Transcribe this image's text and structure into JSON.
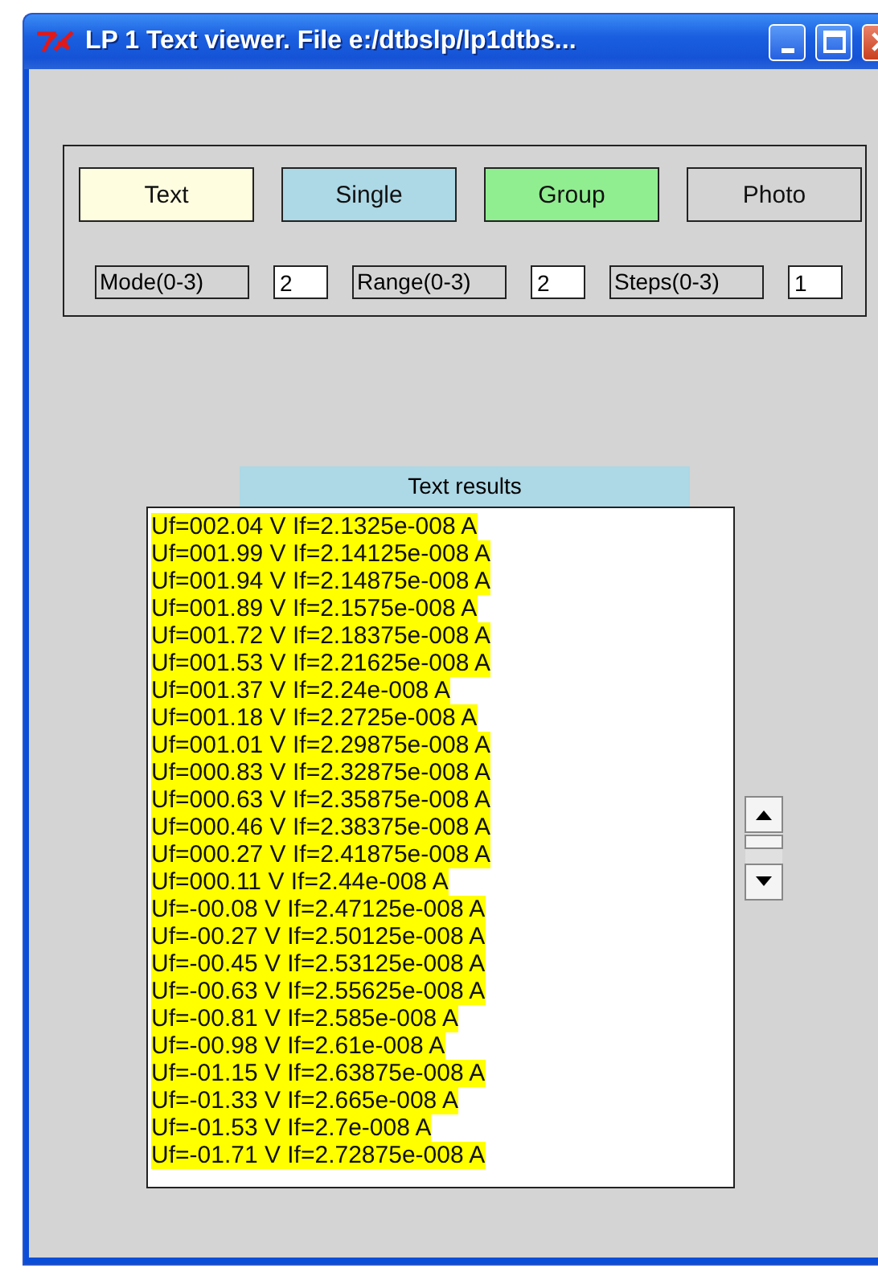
{
  "window": {
    "title": "LP 1 Text viewer. File e:/dtbslp/lp1dtbs..."
  },
  "buttons": [
    {
      "label": "Text",
      "color": "#fffde0"
    },
    {
      "label": "Single",
      "color": "#add8e6"
    },
    {
      "label": "Group",
      "color": "#90ee90"
    },
    {
      "label": "Photo",
      "color": "#d4d4d4"
    }
  ],
  "params": [
    {
      "label": "Mode(0-3)",
      "value": "2"
    },
    {
      "label": "Range(0-3)",
      "value": "2"
    },
    {
      "label": "Steps(0-3)",
      "value": "1"
    }
  ],
  "results": {
    "title": "Text results",
    "lines": [
      "Uf=002.04 V If=2.1325e-008 A",
      "Uf=001.99 V If=2.14125e-008 A",
      "Uf=001.94 V If=2.14875e-008 A",
      "Uf=001.89 V If=2.1575e-008 A",
      "Uf=001.72 V If=2.18375e-008 A",
      "Uf=001.53 V If=2.21625e-008 A",
      "Uf=001.37 V If=2.24e-008 A",
      "Uf=001.18 V If=2.2725e-008 A",
      "Uf=001.01 V If=2.29875e-008 A",
      "Uf=000.83 V If=2.32875e-008 A",
      "Uf=000.63 V If=2.35875e-008 A",
      "Uf=000.46 V If=2.38375e-008 A",
      "Uf=000.27 V If=2.41875e-008 A",
      "Uf=000.11 V If=2.44e-008 A",
      "Uf=-00.08 V If=2.47125e-008 A",
      "Uf=-00.27 V If=2.50125e-008 A",
      "Uf=-00.45 V If=2.53125e-008 A",
      "Uf=-00.63 V If=2.55625e-008 A",
      "Uf=-00.81 V If=2.585e-008 A",
      "Uf=-00.98 V If=2.61e-008 A",
      "Uf=-01.15 V If=2.63875e-008 A",
      "Uf=-01.33 V If=2.665e-008 A",
      "Uf=-01.53 V If=2.7e-008 A",
      "Uf=-01.71 V If=2.72875e-008 A"
    ]
  }
}
